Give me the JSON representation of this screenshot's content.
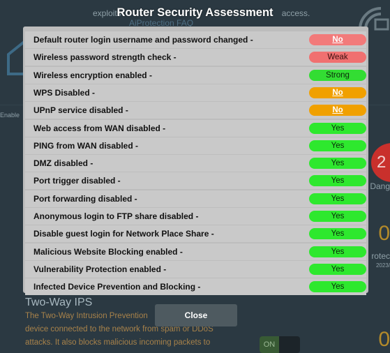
{
  "title": "Router Security Assessment",
  "close_label": "Close",
  "background": {
    "top_line_1": "exploits",
    "top_line_1_right": "access.",
    "top_line_2": "AiProtection FAQ",
    "side_left": "Enable",
    "badge_number": "2",
    "side_label_1": "Dang",
    "side_number_1": "0",
    "side_label_2": "rotec",
    "side_label_2_sub": "2023/",
    "side_number_2": "0",
    "panel_title": "Two-Way IPS",
    "panel_desc_1": "The Two-Way Intrusion Prevention",
    "panel_desc_2": "device connected to the network from spam or DDoS",
    "panel_desc_3": "attacks. It also blocks malicious incoming packets to",
    "toggle_label": "ON"
  },
  "colors": {
    "no_red": "#f27a7a",
    "weak_red": "#f07070",
    "strong_green": "#33dd33",
    "yes_green": "#2ee82e",
    "no_orange": "#f0a000"
  },
  "checks": [
    {
      "label": "Default router login username and password changed -",
      "status": "No",
      "status_kind": "no-red"
    },
    {
      "label": "Wireless password strength check -",
      "status": "Weak",
      "status_kind": "weak"
    },
    {
      "label": "Wireless encryption enabled -",
      "status": "Strong",
      "status_kind": "strong"
    },
    {
      "label": "WPS Disabled -",
      "status": "No",
      "status_kind": "no-orange"
    },
    {
      "label": "UPnP service disabled -",
      "status": "No",
      "status_kind": "no-orange"
    },
    {
      "label": "Web access from WAN disabled -",
      "status": "Yes",
      "status_kind": "yes"
    },
    {
      "label": "PING from WAN disabled -",
      "status": "Yes",
      "status_kind": "yes"
    },
    {
      "label": "DMZ disabled -",
      "status": "Yes",
      "status_kind": "yes"
    },
    {
      "label": "Port trigger disabled -",
      "status": "Yes",
      "status_kind": "yes"
    },
    {
      "label": "Port forwarding disabled -",
      "status": "Yes",
      "status_kind": "yes"
    },
    {
      "label": "Anonymous login to FTP share disabled -",
      "status": "Yes",
      "status_kind": "yes"
    },
    {
      "label": "Disable guest login for Network Place Share -",
      "status": "Yes",
      "status_kind": "yes"
    },
    {
      "label": "Malicious Website Blocking enabled -",
      "status": "Yes",
      "status_kind": "yes"
    },
    {
      "label": "Vulnerability Protection enabled -",
      "status": "Yes",
      "status_kind": "yes"
    },
    {
      "label": "Infected Device Prevention and Blocking -",
      "status": "Yes",
      "status_kind": "yes"
    }
  ]
}
